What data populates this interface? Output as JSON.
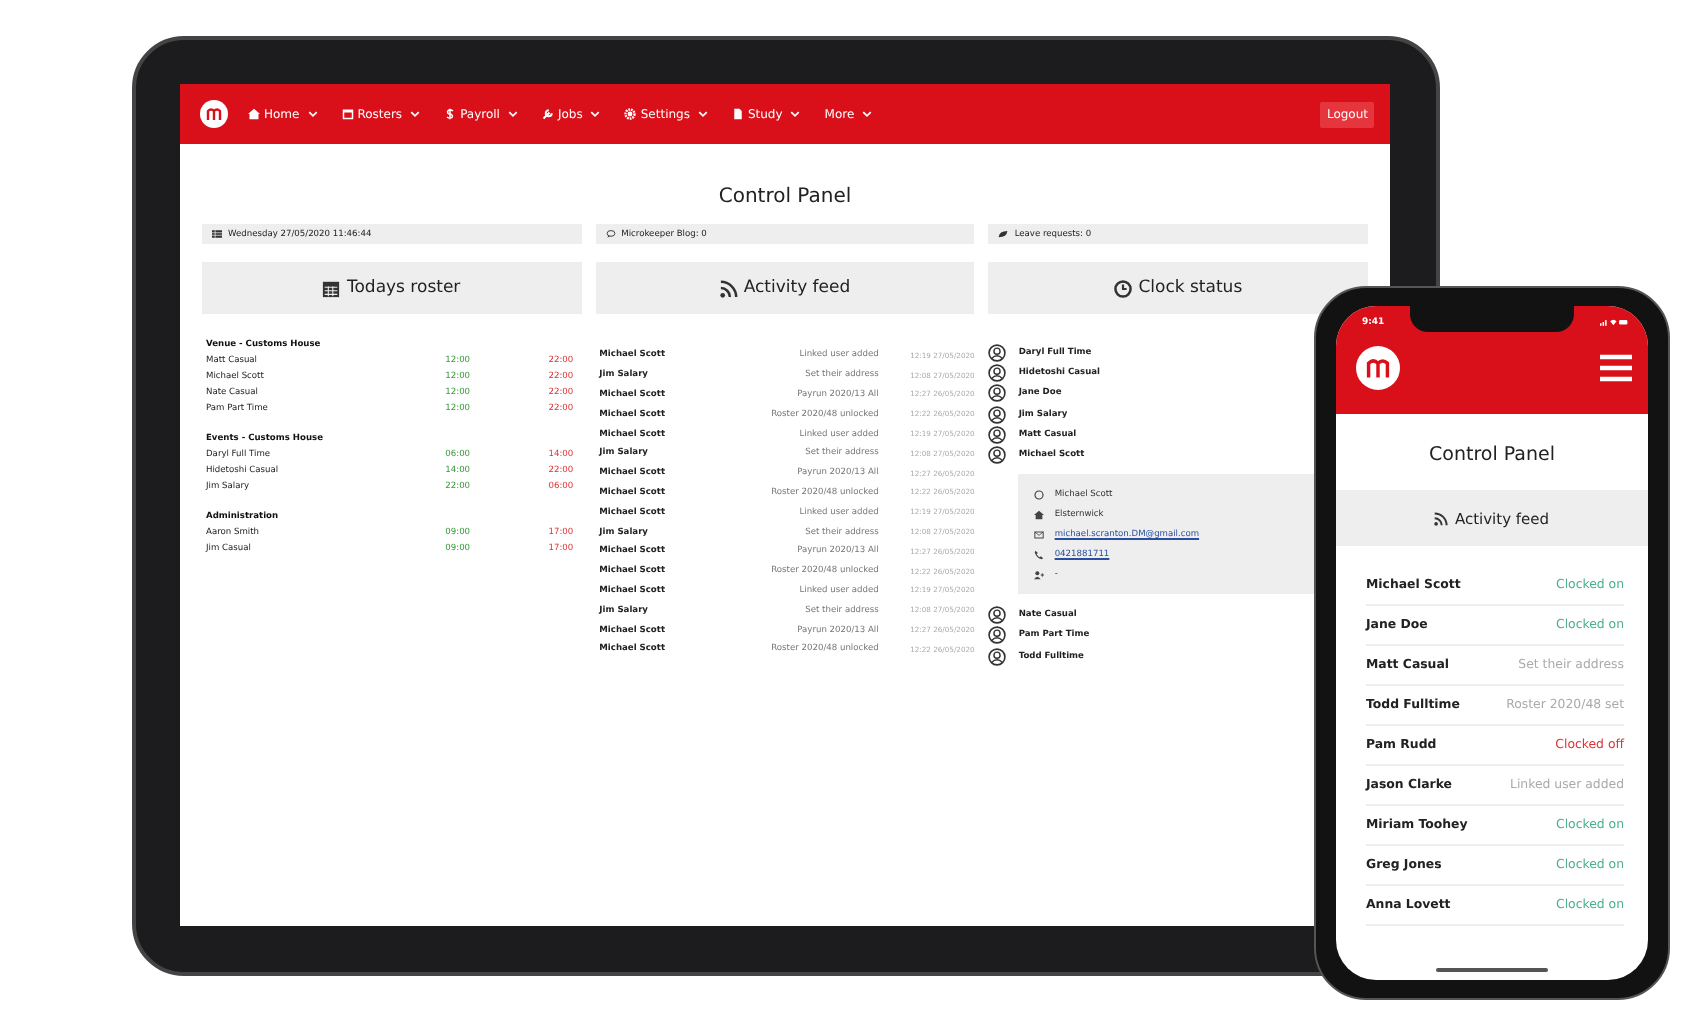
{
  "tablet": {
    "nav": {
      "items": [
        {
          "label": "Home"
        },
        {
          "label": "Rosters"
        },
        {
          "label": "Payroll"
        },
        {
          "label": "Jobs"
        },
        {
          "label": "Settings"
        },
        {
          "label": "Study"
        },
        {
          "label": "More"
        }
      ],
      "logout": "Logout"
    },
    "title": "Control Panel",
    "info_bars": [
      "Wednesday 27/05/2020 11:46:44",
      "Microkeeper Blog: 0",
      "Leave requests: 0"
    ],
    "roster": {
      "heading": "Todays roster",
      "groups": [
        {
          "name": "Venue - Customs House",
          "shifts": [
            {
              "name": "Matt Casual",
              "start": "12:00",
              "end": "22:00"
            },
            {
              "name": "Michael Scott",
              "start": "12:00",
              "end": "22:00"
            },
            {
              "name": "Nate Casual",
              "start": "12:00",
              "end": "22:00"
            },
            {
              "name": "Pam Part Time",
              "start": "12:00",
              "end": "22:00"
            }
          ]
        },
        {
          "name": "Events - Customs House",
          "shifts": [
            {
              "name": "Daryl Full Time",
              "start": "06:00",
              "end": "14:00"
            },
            {
              "name": "Hidetoshi Casual",
              "start": "14:00",
              "end": "22:00"
            },
            {
              "name": "Jim Salary",
              "start": "22:00",
              "end": "06:00"
            }
          ]
        },
        {
          "name": "Administration",
          "shifts": [
            {
              "name": "Aaron Smith",
              "start": "09:00",
              "end": "17:00"
            },
            {
              "name": "Jim Casual",
              "start": "09:00",
              "end": "17:00"
            }
          ]
        }
      ]
    },
    "activity": {
      "heading": "Activity feed",
      "rows": [
        {
          "name": "Michael Scott",
          "action": "Linked user added",
          "time": "12:19 27/05/2020"
        },
        {
          "name": "Jim Salary",
          "action": "Set their address",
          "time": "12:08 27/05/2020"
        },
        {
          "name": "Michael Scott",
          "action": "Payrun 2020/13 All",
          "time": "12:27 26/05/2020"
        },
        {
          "name": "Michael Scott",
          "action": "Roster 2020/48 unlocked",
          "time": "12:22 26/05/2020"
        },
        {
          "name": "Michael Scott",
          "action": "Linked user added",
          "time": "12:19 27/05/2020"
        },
        {
          "name": "Jim Salary",
          "action": "Set their address",
          "time": "12:08 27/05/2020"
        },
        {
          "name": "Michael Scott",
          "action": "Payrun 2020/13 All",
          "time": "12:27 26/05/2020"
        },
        {
          "name": "Michael Scott",
          "action": "Roster 2020/48 unlocked",
          "time": "12:22 26/05/2020"
        },
        {
          "name": "Michael Scott",
          "action": "Linked user added",
          "time": "12:19 27/05/2020"
        },
        {
          "name": "Jim Salary",
          "action": "Set their address",
          "time": "12:08 27/05/2020"
        },
        {
          "name": "Michael Scott",
          "action": "Payrun 2020/13 All",
          "time": "12:27 26/05/2020"
        },
        {
          "name": "Michael Scott",
          "action": "Roster 2020/48 unlocked",
          "time": "12:22 26/05/2020"
        },
        {
          "name": "Michael Scott",
          "action": "Linked user added",
          "time": "12:19 27/05/2020"
        },
        {
          "name": "Jim Salary",
          "action": "Set their address",
          "time": "12:08 27/05/2020"
        },
        {
          "name": "Michael Scott",
          "action": "Payrun 2020/13 All",
          "time": "12:27 26/05/2020"
        },
        {
          "name": "Michael Scott",
          "action": "Roster 2020/48 unlocked",
          "time": "12:22 26/05/2020"
        }
      ]
    },
    "clock": {
      "heading": "Clock status",
      "staff": [
        {
          "name": "Daryl Full Time"
        },
        {
          "name": "Hidetoshi Casual"
        },
        {
          "name": "Jane Doe"
        },
        {
          "name": "Jim Salary"
        },
        {
          "name": "Matt Casual"
        },
        {
          "name": "Michael Scott",
          "details": {
            "name": "Michael Scott",
            "suburb": "Elsternwick",
            "email": "michael.scranton.DM@gmail.com",
            "phone": "0421881711",
            "role": "-"
          }
        },
        {
          "name": "Nate Casual"
        },
        {
          "name": "Pam Part Time"
        },
        {
          "name": "Todd Fulltime"
        }
      ]
    }
  },
  "phone": {
    "time": "9:41",
    "title": "Control Panel",
    "feed_heading": "Activity feed",
    "rows": [
      {
        "name": "Michael Scott",
        "status": "Clocked on",
        "kind": "on"
      },
      {
        "name": "Jane Doe",
        "status": "Clocked on",
        "kind": "on"
      },
      {
        "name": "Matt Casual",
        "status": "Set their address",
        "kind": "info"
      },
      {
        "name": "Todd Fulltime",
        "status": "Roster 2020/48 set",
        "kind": "info"
      },
      {
        "name": "Pam Rudd",
        "status": "Clocked off",
        "kind": "off"
      },
      {
        "name": "Jason Clarke",
        "status": "Linked user added",
        "kind": "info"
      },
      {
        "name": "Miriam Toohey",
        "status": "Clocked on",
        "kind": "on"
      },
      {
        "name": "Greg Jones",
        "status": "Clocked on",
        "kind": "on"
      },
      {
        "name": "Anna Lovett",
        "status": "Clocked on",
        "kind": "on"
      }
    ]
  }
}
